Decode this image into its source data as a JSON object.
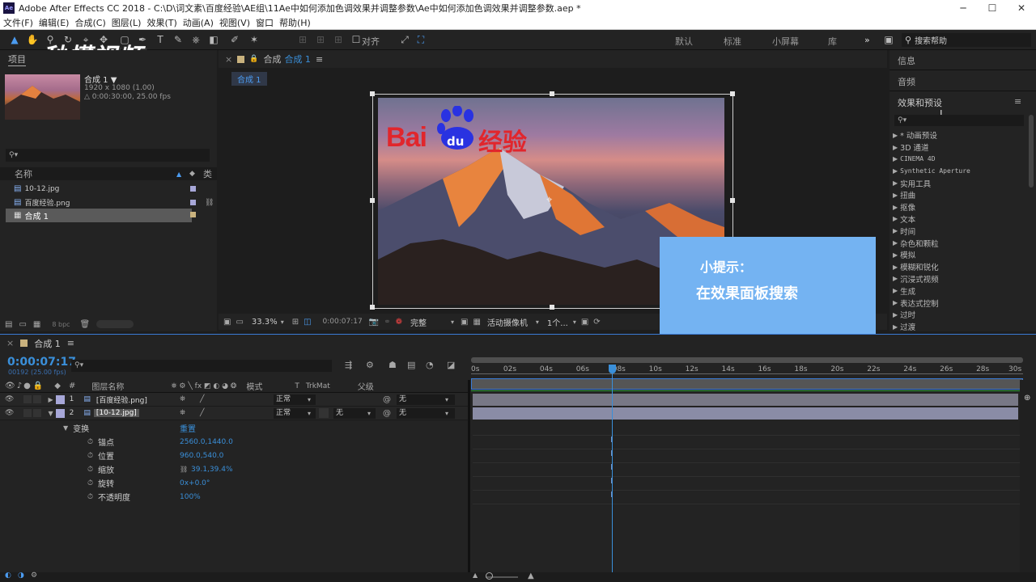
{
  "window": {
    "title": "Adobe After Effects CC 2018 - C:\\D\\词文素\\百度经验\\AE组\\11Ae中如何添加色调效果并调整参数\\Ae中如何添加色调效果并调整参数.aep *",
    "app_badge": "Ae",
    "min": "─",
    "max": "☐",
    "close": "✕"
  },
  "menu": [
    "文件(F)",
    "编辑(E)",
    "合成(C)",
    "图层(L)",
    "效果(T)",
    "动画(A)",
    "视图(V)",
    "窗口",
    "帮助(H)"
  ],
  "toolbar": {
    "align_label": "对齐",
    "workspaces": [
      "默认",
      "标准",
      "小屏幕",
      "库"
    ],
    "more": "»",
    "search_help": "搜索帮助"
  },
  "watermark": "秒懂视频",
  "project": {
    "tab": "项目",
    "comp_name": "合成 1 ▼",
    "comp_size": "1920 x 1080 (1.00)",
    "comp_duration": "△ 0:00:30:00, 25.00 fps",
    "search_icon_text": "⚲▾",
    "col_name": "名称",
    "col_type": "类",
    "items": [
      {
        "name": "10-12.jpg",
        "color": "#a7a7d8"
      },
      {
        "name": "百度经验.png",
        "color": "#a7a7d8"
      },
      {
        "name": "合成 1",
        "color": "#c9b27e"
      }
    ],
    "bpc": "8 bpc"
  },
  "comp_panel": {
    "tab_prefix": "合成",
    "tab_name": "合成 1",
    "menu_icon": "≡",
    "subtab": "合成 1",
    "zoom": "33.3%",
    "time": "0:00:07:17",
    "quality": "完整",
    "camera": "活动摄像机",
    "views": "1个..."
  },
  "baidu": {
    "bai": "Bai",
    "du": "du",
    "jingyan": "经验"
  },
  "tip": {
    "title": "小提示：",
    "body": "在效果面板搜索"
  },
  "right_panel": {
    "tabs": [
      "信息",
      "音频"
    ],
    "effects_title": "效果和预设",
    "menu_icon": "≡",
    "search_placeholder": "⚲▾",
    "categories": [
      "* 动画预设",
      "3D 通道",
      "CINEMA 4D",
      "Synthetic Aperture",
      "实用工具",
      "扭曲",
      "抠像",
      "文本",
      "时间",
      "杂色和颗粒",
      "模拟",
      "模糊和锐化",
      "沉浸式视频",
      "生成",
      "表达式控制",
      "过时",
      "过渡"
    ]
  },
  "timeline": {
    "tab": "合成 1",
    "menu_icon": "≡",
    "timecode": "0:00:07:17",
    "frames": "00192 (25.00 fps)",
    "search": "⚲▾",
    "headers": {
      "num": "#",
      "layer_name": "图层名称",
      "mode": "模式",
      "t": "T",
      "trkmat": "TrkMat",
      "parent": "父级"
    },
    "ruler": [
      "0s",
      "02s",
      "04s",
      "06s",
      "08s",
      "10s",
      "12s",
      "14s",
      "16s",
      "18s",
      "20s",
      "22s",
      "24s",
      "26s",
      "28s",
      "30s"
    ],
    "playhead_pct": 0.2556,
    "layers": [
      {
        "num": "1",
        "name": "[百度经验.png]",
        "mode": "正常",
        "trk": "",
        "parent": "无"
      },
      {
        "num": "2",
        "name": "[10-12.jpg]",
        "mode": "正常",
        "trk": "无",
        "parent": "无"
      }
    ],
    "transform": {
      "label": "变换",
      "reset": "重置",
      "props": [
        {
          "name": "锚点",
          "value": "2560.0,1440.0"
        },
        {
          "name": "位置",
          "value": "960.0,540.0"
        },
        {
          "name": "缩放",
          "value": "39.1,39.4%"
        },
        {
          "name": "旋转",
          "value": "0x+0.0°"
        },
        {
          "name": "不透明度",
          "value": "100%"
        }
      ]
    }
  }
}
